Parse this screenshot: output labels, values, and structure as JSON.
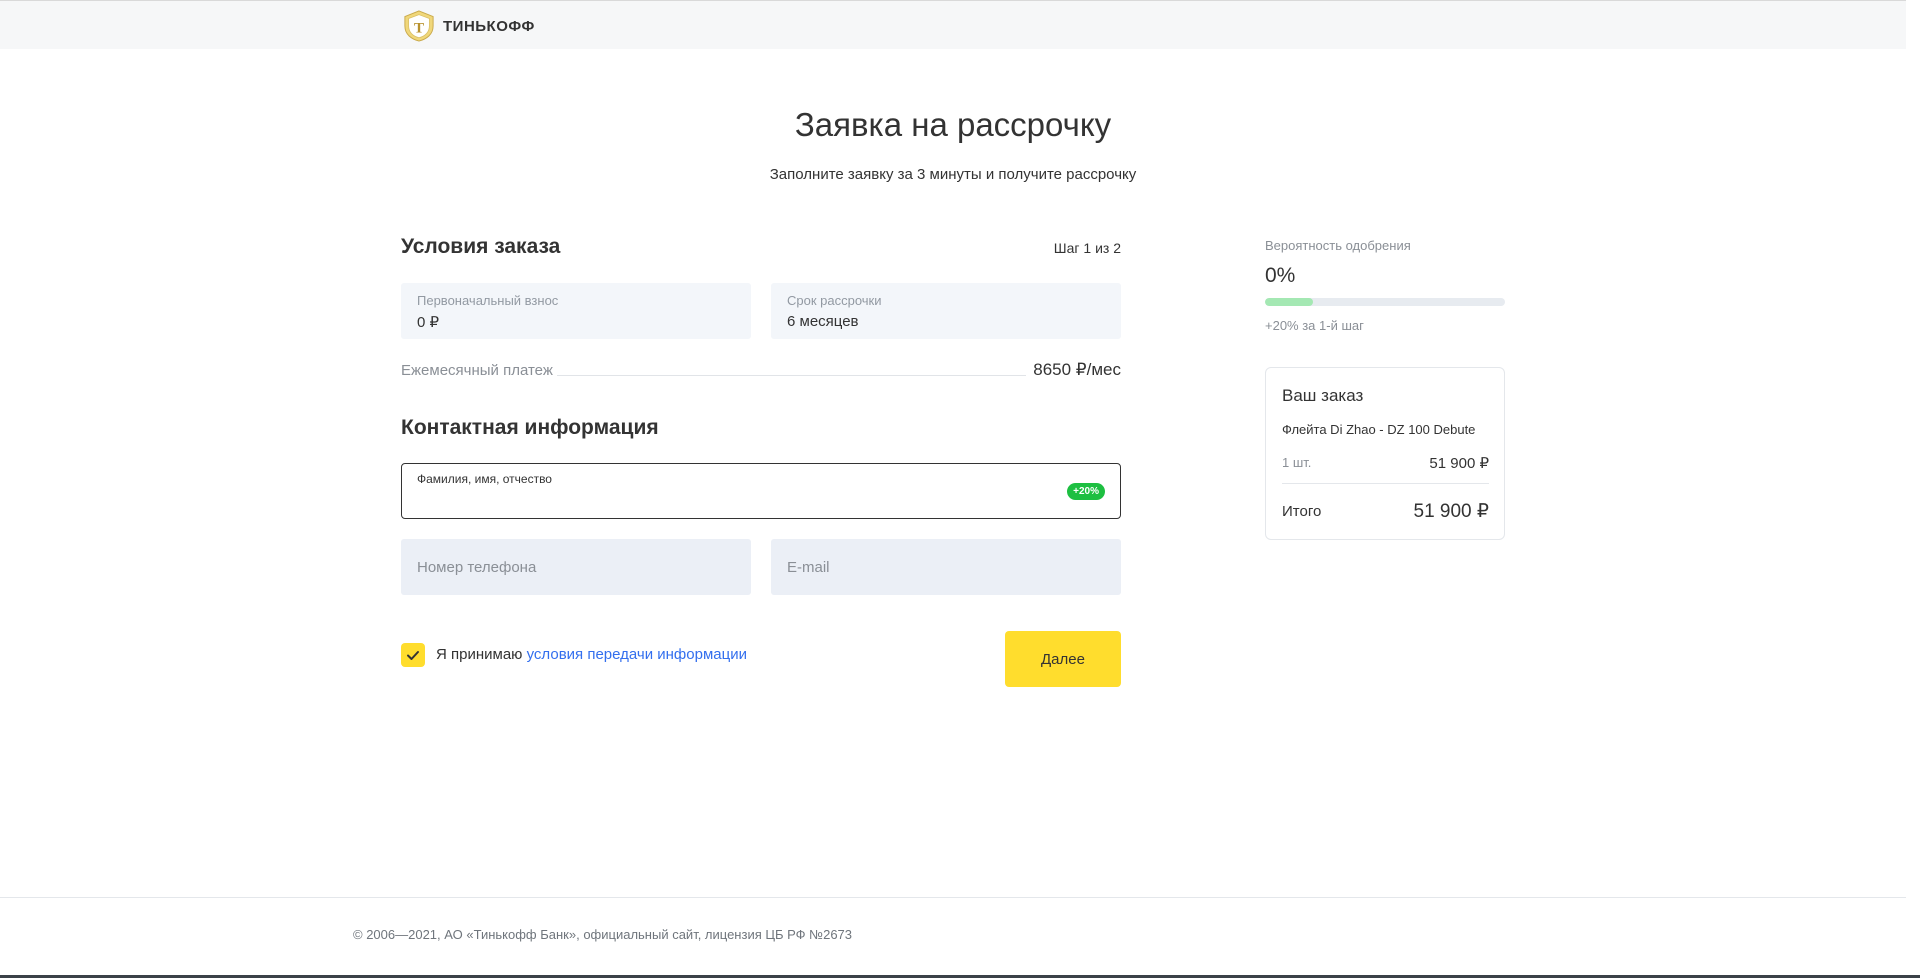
{
  "header": {
    "brand": "ТИНЬКОФФ",
    "logo_icon": "tinkoff-shield-icon"
  },
  "page": {
    "title": "Заявка на рассрочку",
    "subtitle": "Заполните заявку за 3 минуты и получите рассрочку"
  },
  "order_conditions": {
    "title": "Условия заказа",
    "step": "Шаг 1 из 2",
    "down_payment": {
      "label": "Первоначальный взнос",
      "value": "0 ₽"
    },
    "term": {
      "label": "Срок рассрочки",
      "value": "6 месяцев"
    },
    "monthly": {
      "label": "Ежемесячный платеж",
      "value": "8650 ₽/мес"
    }
  },
  "contact": {
    "title": "Контактная информация",
    "fio": {
      "label": "Фамилия, имя, отчество",
      "badge": "+20%"
    },
    "phone": {
      "placeholder": "Номер телефона"
    },
    "email": {
      "placeholder": "E-mail"
    }
  },
  "consent": {
    "text": "Я принимаю ",
    "link": "условия передачи информации",
    "checked": true,
    "icon": "checkmark-icon"
  },
  "actions": {
    "next_label": "Далее"
  },
  "approval": {
    "label": "Вероятность одобрения",
    "value": "0%",
    "progress_fraction": 0.2,
    "hint": "+20% за 1-й шаг"
  },
  "order_summary": {
    "title": "Ваш заказ",
    "product": "Флейта Di Zhao - DZ 100 Debute",
    "qty": "1 шт.",
    "price": "51 900 ₽",
    "total_label": "Итого",
    "total_value": "51 900 ₽"
  },
  "footer": {
    "text": "© 2006—2021, АО «Тинькофф Банк», официальный сайт, лицензия ЦБ РФ №2673"
  },
  "colors": {
    "accent_yellow": "#ffdd2d",
    "link_blue": "#336fee",
    "badge_green": "#1dbf41",
    "progress_green": "#a4e8b3"
  }
}
